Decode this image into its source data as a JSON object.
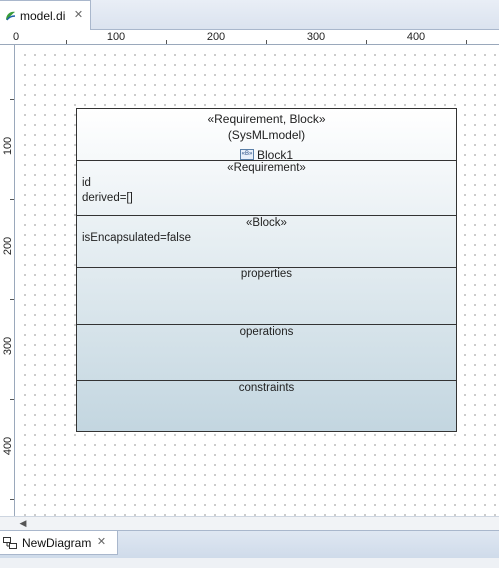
{
  "editor_tab": {
    "label": "model.di",
    "icon": "papyrus-model-icon",
    "close_icon": "close-icon"
  },
  "ruler_top": {
    "labels": [
      "0",
      "100",
      "200",
      "300",
      "400"
    ]
  },
  "ruler_left": {
    "labels": [
      "100",
      "200",
      "300",
      "400"
    ]
  },
  "block": {
    "stereotypes": "«Requirement, Block»",
    "namespace": "(SysMLmodel)",
    "name": "Block1",
    "name_icon": "block-icon",
    "compartments": {
      "requirement": {
        "title": "«Requirement»",
        "lines": [
          "id",
          "derived=[]"
        ]
      },
      "block": {
        "title": "«Block»",
        "lines": [
          "isEncapsulated=false"
        ]
      },
      "properties": {
        "title": "properties"
      },
      "operations": {
        "title": "operations"
      },
      "constraints": {
        "title": "constraints"
      }
    }
  },
  "diagram_tab": {
    "label": "NewDiagram",
    "icon": "diagram-icon",
    "close_icon": "close-icon"
  },
  "colors": {
    "block_gradient_top": "#ffffff",
    "block_gradient_bottom": "#c3d6e0",
    "tab_active": "#ffffff",
    "tab_bar": "#dbe3ef"
  }
}
